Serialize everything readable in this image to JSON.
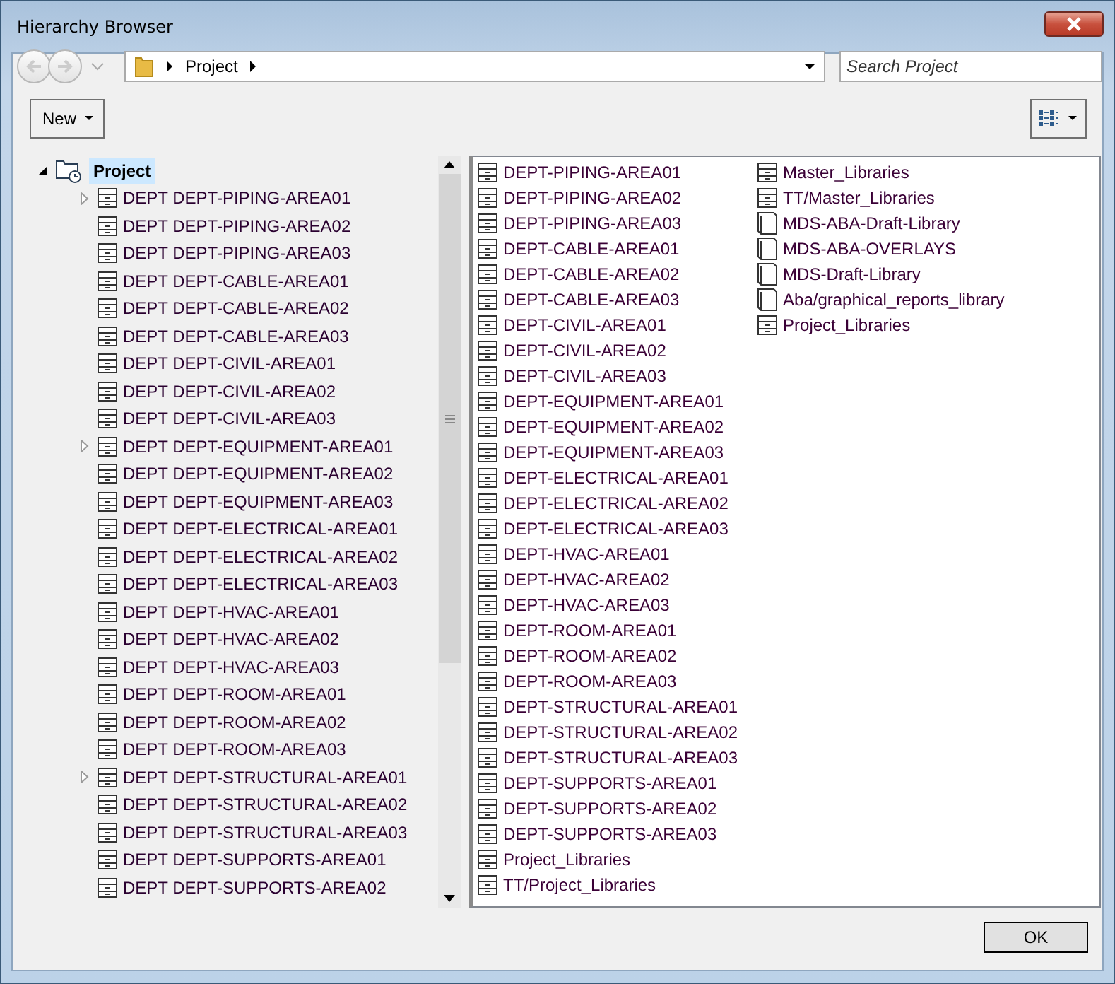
{
  "window": {
    "title": "Hierarchy Browser"
  },
  "address_bar": {
    "path": [
      "Project"
    ]
  },
  "search": {
    "placeholder": "Search Project"
  },
  "toolbar": {
    "new_button": "New"
  },
  "tree": {
    "label": "Project",
    "expanded": true,
    "selected": true,
    "children": [
      {
        "label": "DEPT DEPT-PIPING-AREA01",
        "expandable": true
      },
      {
        "label": "DEPT DEPT-PIPING-AREA02",
        "expandable": false
      },
      {
        "label": "DEPT DEPT-PIPING-AREA03",
        "expandable": false
      },
      {
        "label": "DEPT DEPT-CABLE-AREA01",
        "expandable": false
      },
      {
        "label": "DEPT DEPT-CABLE-AREA02",
        "expandable": false
      },
      {
        "label": "DEPT DEPT-CABLE-AREA03",
        "expandable": false
      },
      {
        "label": "DEPT DEPT-CIVIL-AREA01",
        "expandable": false
      },
      {
        "label": "DEPT DEPT-CIVIL-AREA02",
        "expandable": false
      },
      {
        "label": "DEPT DEPT-CIVIL-AREA03",
        "expandable": false
      },
      {
        "label": "DEPT DEPT-EQUIPMENT-AREA01",
        "expandable": true
      },
      {
        "label": "DEPT DEPT-EQUIPMENT-AREA02",
        "expandable": false
      },
      {
        "label": "DEPT DEPT-EQUIPMENT-AREA03",
        "expandable": false
      },
      {
        "label": "DEPT DEPT-ELECTRICAL-AREA01",
        "expandable": false
      },
      {
        "label": "DEPT DEPT-ELECTRICAL-AREA02",
        "expandable": false
      },
      {
        "label": "DEPT DEPT-ELECTRICAL-AREA03",
        "expandable": false
      },
      {
        "label": "DEPT DEPT-HVAC-AREA01",
        "expandable": false
      },
      {
        "label": "DEPT DEPT-HVAC-AREA02",
        "expandable": false
      },
      {
        "label": "DEPT DEPT-HVAC-AREA03",
        "expandable": false
      },
      {
        "label": "DEPT DEPT-ROOM-AREA01",
        "expandable": false
      },
      {
        "label": "DEPT DEPT-ROOM-AREA02",
        "expandable": false
      },
      {
        "label": "DEPT DEPT-ROOM-AREA03",
        "expandable": false
      },
      {
        "label": "DEPT DEPT-STRUCTURAL-AREA01",
        "expandable": true
      },
      {
        "label": "DEPT DEPT-STRUCTURAL-AREA02",
        "expandable": false
      },
      {
        "label": "DEPT DEPT-STRUCTURAL-AREA03",
        "expandable": false
      },
      {
        "label": "DEPT DEPT-SUPPORTS-AREA01",
        "expandable": false
      },
      {
        "label": "DEPT DEPT-SUPPORTS-AREA02",
        "expandable": false
      }
    ]
  },
  "list_columns": [
    [
      {
        "label": "DEPT-PIPING-AREA01",
        "kind": "cabinet"
      },
      {
        "label": "DEPT-PIPING-AREA02",
        "kind": "cabinet"
      },
      {
        "label": "DEPT-PIPING-AREA03",
        "kind": "cabinet"
      },
      {
        "label": "DEPT-CABLE-AREA01",
        "kind": "cabinet"
      },
      {
        "label": "DEPT-CABLE-AREA02",
        "kind": "cabinet"
      },
      {
        "label": "DEPT-CABLE-AREA03",
        "kind": "cabinet"
      },
      {
        "label": "DEPT-CIVIL-AREA01",
        "kind": "cabinet"
      },
      {
        "label": "DEPT-CIVIL-AREA02",
        "kind": "cabinet"
      },
      {
        "label": "DEPT-CIVIL-AREA03",
        "kind": "cabinet"
      },
      {
        "label": "DEPT-EQUIPMENT-AREA01",
        "kind": "cabinet"
      },
      {
        "label": "DEPT-EQUIPMENT-AREA02",
        "kind": "cabinet"
      },
      {
        "label": "DEPT-EQUIPMENT-AREA03",
        "kind": "cabinet"
      },
      {
        "label": "DEPT-ELECTRICAL-AREA01",
        "kind": "cabinet"
      },
      {
        "label": "DEPT-ELECTRICAL-AREA02",
        "kind": "cabinet"
      },
      {
        "label": "DEPT-ELECTRICAL-AREA03",
        "kind": "cabinet"
      },
      {
        "label": "DEPT-HVAC-AREA01",
        "kind": "cabinet"
      },
      {
        "label": "DEPT-HVAC-AREA02",
        "kind": "cabinet"
      },
      {
        "label": "DEPT-HVAC-AREA03",
        "kind": "cabinet"
      },
      {
        "label": "DEPT-ROOM-AREA01",
        "kind": "cabinet"
      },
      {
        "label": "DEPT-ROOM-AREA02",
        "kind": "cabinet"
      },
      {
        "label": "DEPT-ROOM-AREA03",
        "kind": "cabinet"
      },
      {
        "label": "DEPT-STRUCTURAL-AREA01",
        "kind": "cabinet"
      },
      {
        "label": "DEPT-STRUCTURAL-AREA02",
        "kind": "cabinet"
      },
      {
        "label": "DEPT-STRUCTURAL-AREA03",
        "kind": "cabinet"
      },
      {
        "label": "DEPT-SUPPORTS-AREA01",
        "kind": "cabinet"
      },
      {
        "label": "DEPT-SUPPORTS-AREA02",
        "kind": "cabinet"
      },
      {
        "label": "DEPT-SUPPORTS-AREA03",
        "kind": "cabinet"
      },
      {
        "label": "Project_Libraries",
        "kind": "cabinet"
      },
      {
        "label": "TT/Project_Libraries",
        "kind": "cabinet"
      }
    ],
    [
      {
        "label": "Master_Libraries",
        "kind": "cabinet"
      },
      {
        "label": "TT/Master_Libraries",
        "kind": "cabinet"
      },
      {
        "label": "MDS-ABA-Draft-Library",
        "kind": "page"
      },
      {
        "label": "MDS-ABA-OVERLAYS",
        "kind": "page"
      },
      {
        "label": "MDS-Draft-Library",
        "kind": "page"
      },
      {
        "label": "Aba/graphical_reports_library",
        "kind": "page"
      },
      {
        "label": "Project_Libraries",
        "kind": "cabinet"
      }
    ]
  ],
  "buttons": {
    "ok": "OK"
  }
}
